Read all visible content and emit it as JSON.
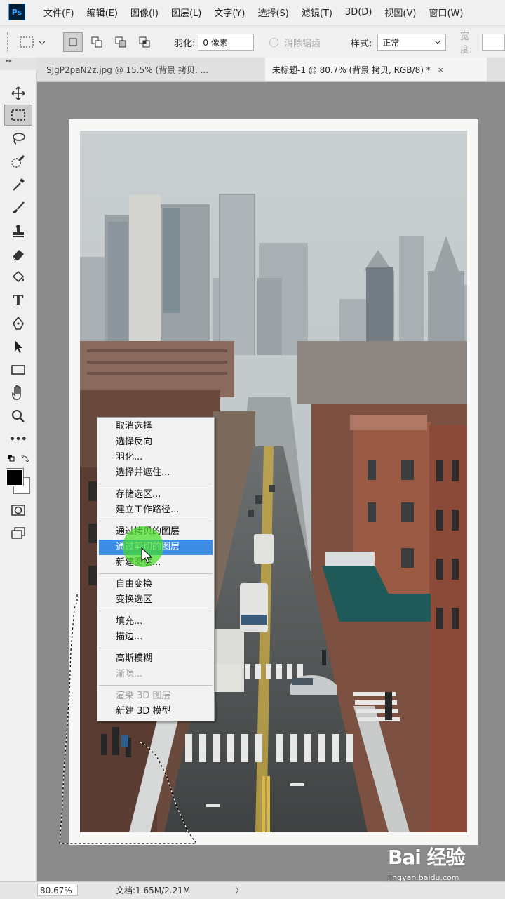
{
  "app": {
    "logo": "Ps"
  },
  "menubar": {
    "items": [
      "文件(F)",
      "编辑(E)",
      "图像(I)",
      "图层(L)",
      "文字(Y)",
      "选择(S)",
      "滤镜(T)",
      "3D(D)",
      "视图(V)",
      "窗口(W)"
    ]
  },
  "options": {
    "feather_label": "羽化:",
    "feather_value": "0 像素",
    "antialias_label": "消除锯齿",
    "style_label": "样式:",
    "style_value": "正常",
    "width_label": "宽度:"
  },
  "tabs": [
    {
      "label": "SJgP2paN2z.jpg @ 15.5% (背景 拷贝, ...",
      "close": "×",
      "active": false
    },
    {
      "label": "未标题-1 @ 80.7% (背景 拷贝, RGB/8) *",
      "close": "×",
      "active": true
    }
  ],
  "tools": [
    "move-icon",
    "rect-marquee-icon",
    "lasso-icon",
    "quick-select-icon",
    "eyedropper-icon",
    "brush-icon",
    "stamp-icon",
    "eraser-icon",
    "paint-bucket-icon",
    "type-icon",
    "pen-icon",
    "path-select-icon",
    "rectangle-icon",
    "hand-icon",
    "zoom-icon",
    "more-icon"
  ],
  "tool_labels": {
    "type": "T",
    "more": "•••"
  },
  "context_menu": {
    "groups": [
      [
        {
          "label": "取消选择",
          "enabled": true
        },
        {
          "label": "选择反向",
          "enabled": true
        },
        {
          "label": "羽化...",
          "enabled": true
        },
        {
          "label": "选择并遮住...",
          "enabled": true
        }
      ],
      [
        {
          "label": "存储选区...",
          "enabled": true
        },
        {
          "label": "建立工作路径...",
          "enabled": true
        }
      ],
      [
        {
          "label": "通过拷贝的图层",
          "enabled": true
        },
        {
          "label": "通过剪切的图层",
          "enabled": true,
          "highlighted": true
        },
        {
          "label": "新建图层...",
          "enabled": true
        }
      ],
      [
        {
          "label": "自由变换",
          "enabled": true
        },
        {
          "label": "变换选区",
          "enabled": true
        }
      ],
      [
        {
          "label": "填充...",
          "enabled": true
        },
        {
          "label": "描边...",
          "enabled": true
        }
      ],
      [
        {
          "label": "高斯模糊",
          "enabled": true
        },
        {
          "label": "渐隐...",
          "enabled": false
        }
      ],
      [
        {
          "label": "渲染 3D 图层",
          "enabled": false
        },
        {
          "label": "新建 3D 模型",
          "enabled": true
        }
      ]
    ]
  },
  "status": {
    "zoom": "80.67%",
    "doc_info": "文档:1.65M/2.21M",
    "arrow": "〉"
  },
  "watermark": {
    "brand": "Bai 经验",
    "url": "jingyan.baidu.com"
  },
  "colors": {
    "highlight": "#3c8ce6",
    "canvas_bg": "#8b8b8b",
    "click_indicator": "#46dc28"
  }
}
